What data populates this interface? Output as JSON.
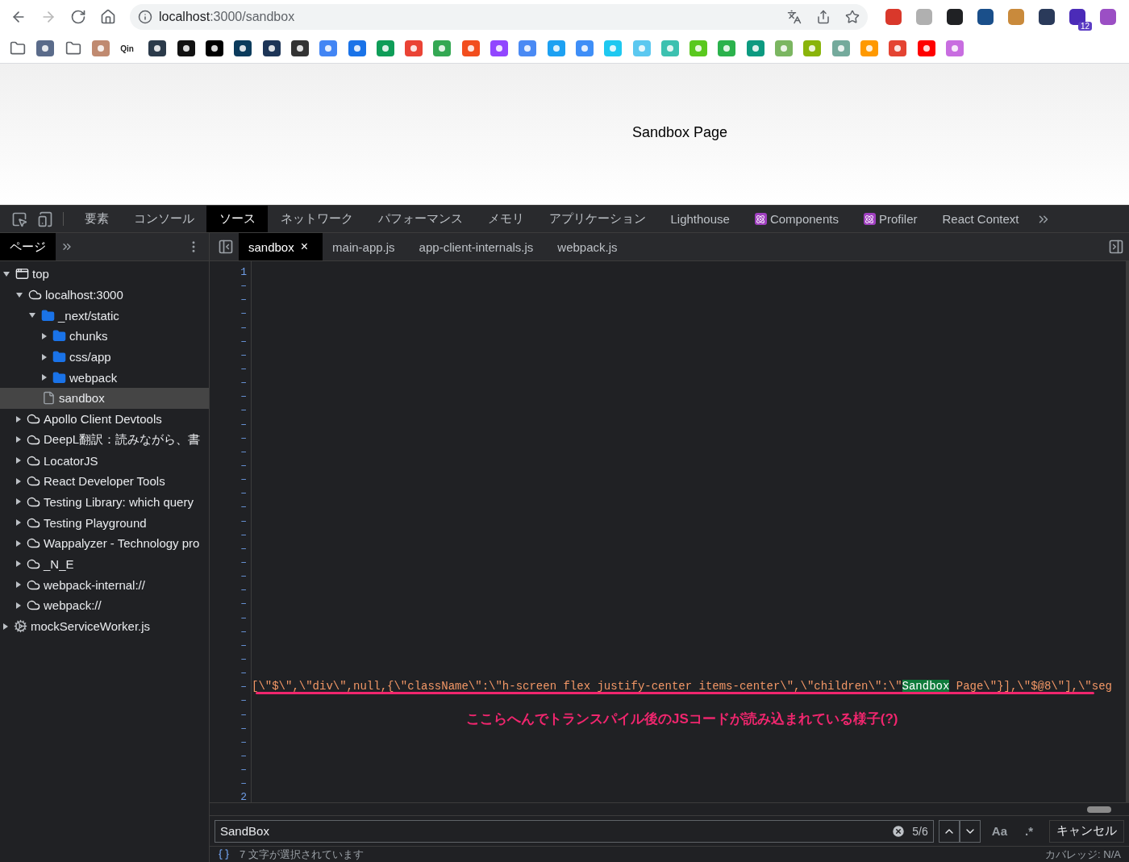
{
  "browser": {
    "nav": [
      {
        "kind": "back",
        "disabled": false
      },
      {
        "kind": "forward",
        "disabled": true
      },
      {
        "kind": "reload",
        "disabled": false
      },
      {
        "kind": "home",
        "disabled": false
      }
    ],
    "address": {
      "host": "localhost",
      "path": ":3000/sandbox"
    },
    "extensions": [
      {
        "color": "#d9382b"
      },
      {
        "color": "#b0b0b0"
      },
      {
        "color": "#202124"
      },
      {
        "color": "#1a4f8a"
      },
      {
        "color": "#c98a3c"
      },
      {
        "color": "#2a3a5a"
      },
      {
        "color": "#4b2bb8",
        "badge": "12"
      },
      {
        "color": "#9b4fc4"
      }
    ]
  },
  "bookmarks": [
    {
      "kind": "folder"
    },
    {
      "kind": "site",
      "color": "#5a6b8a"
    },
    {
      "kind": "folder"
    },
    {
      "kind": "site",
      "color": "#c08a70"
    },
    {
      "kind": "text",
      "label": "Qin"
    },
    {
      "kind": "site",
      "color": "#2b3a4a"
    },
    {
      "kind": "site",
      "color": "#111111"
    },
    {
      "kind": "site",
      "color": "#000000"
    },
    {
      "kind": "site",
      "color": "#0b3b5c"
    },
    {
      "kind": "site",
      "color": "#1d3557"
    },
    {
      "kind": "site",
      "color": "#333333"
    },
    {
      "kind": "site",
      "color": "#4285f4"
    },
    {
      "kind": "site",
      "color": "#1a73e8"
    },
    {
      "kind": "site",
      "color": "#0f9d58"
    },
    {
      "kind": "site",
      "color": "#ea4335"
    },
    {
      "kind": "site",
      "color": "#34a853"
    },
    {
      "kind": "site",
      "color": "#f24e1e"
    },
    {
      "kind": "site",
      "color": "#9146ff"
    },
    {
      "kind": "site",
      "color": "#4a8af4"
    },
    {
      "kind": "site",
      "color": "#1da1f2"
    },
    {
      "kind": "site",
      "color": "#3e8ef7"
    },
    {
      "kind": "site",
      "color": "#1ec8f0"
    },
    {
      "kind": "site",
      "color": "#5bc8f0"
    },
    {
      "kind": "site",
      "color": "#3cc1b0"
    },
    {
      "kind": "site",
      "color": "#5ac81e"
    },
    {
      "kind": "site",
      "color": "#2bb24c"
    },
    {
      "kind": "site",
      "color": "#0c9a80"
    },
    {
      "kind": "site",
      "color": "#7bb661"
    },
    {
      "kind": "site",
      "color": "#8ab40a"
    },
    {
      "kind": "site",
      "color": "#74aa9c"
    },
    {
      "kind": "site",
      "color": "#ff9900"
    },
    {
      "kind": "site",
      "color": "#e44332"
    },
    {
      "kind": "site",
      "color": "#ff0000"
    },
    {
      "kind": "site",
      "color": "#c86de0"
    }
  ],
  "page": {
    "heading": "Sandbox Page"
  },
  "devtools": {
    "tabs": [
      {
        "label": "要素",
        "kind": "plain",
        "selected": false
      },
      {
        "label": "コンソール",
        "kind": "plain",
        "selected": false
      },
      {
        "label": "ソース",
        "kind": "plain",
        "selected": true
      },
      {
        "label": "ネットワーク",
        "kind": "plain",
        "selected": false
      },
      {
        "label": "パフォーマンス",
        "kind": "plain",
        "selected": false
      },
      {
        "label": "メモリ",
        "kind": "plain",
        "selected": false
      },
      {
        "label": "アプリケーション",
        "kind": "plain",
        "selected": false
      },
      {
        "label": "Lighthouse",
        "kind": "plain",
        "selected": false
      },
      {
        "label": "Components",
        "kind": "react",
        "selected": false
      },
      {
        "label": "Profiler",
        "kind": "react",
        "selected": false
      },
      {
        "label": "React Context",
        "kind": "plain",
        "selected": false
      }
    ],
    "navigator_tab": {
      "label": "ページ",
      "selected": true
    },
    "tree": [
      {
        "label": "top",
        "kind": "frame",
        "expanded": true,
        "selected": false,
        "children": [
          {
            "label": "localhost:3000",
            "kind": "domain",
            "expanded": true,
            "selected": false,
            "children": [
              {
                "label": "_next/static",
                "kind": "folder",
                "expanded": true,
                "selected": false,
                "children": [
                  {
                    "label": "chunks",
                    "kind": "folder",
                    "expanded": false,
                    "selected": false
                  },
                  {
                    "label": "css/app",
                    "kind": "folder",
                    "expanded": false,
                    "selected": false
                  },
                  {
                    "label": "webpack",
                    "kind": "folder",
                    "expanded": false,
                    "selected": false
                  }
                ]
              },
              {
                "label": "sandbox",
                "kind": "file",
                "selected": true
              }
            ]
          },
          {
            "label": "Apollo Client Devtools",
            "kind": "domain",
            "expanded": false,
            "selected": false
          },
          {
            "label": "DeepL翻訳：読みながら、書",
            "kind": "domain",
            "expanded": false,
            "selected": false
          },
          {
            "label": "LocatorJS",
            "kind": "domain",
            "expanded": false,
            "selected": false
          },
          {
            "label": "React Developer Tools",
            "kind": "domain",
            "expanded": false,
            "selected": false
          },
          {
            "label": "Testing Library: which query",
            "kind": "domain",
            "expanded": false,
            "selected": false
          },
          {
            "label": "Testing Playground",
            "kind": "domain",
            "expanded": false,
            "selected": false
          },
          {
            "label": "Wappalyzer - Technology pro",
            "kind": "domain",
            "expanded": false,
            "selected": false
          },
          {
            "label": "_N_E",
            "kind": "domain",
            "expanded": false,
            "selected": false
          },
          {
            "label": "webpack-internal://",
            "kind": "domain",
            "expanded": false,
            "selected": false
          },
          {
            "label": "webpack://",
            "kind": "domain",
            "expanded": false,
            "selected": false
          }
        ]
      },
      {
        "label": "mockServiceWorker.js",
        "kind": "worker",
        "expanded": false,
        "selected": false
      }
    ],
    "editor_tabs": [
      {
        "label": "sandbox",
        "selected": true,
        "close": "×"
      },
      {
        "label": "main-app.js",
        "selected": false
      },
      {
        "label": "app-client-internals.js",
        "selected": false
      },
      {
        "label": "webpack.js",
        "selected": false
      }
    ],
    "lines": [
      {
        "number": "1"
      },
      {
        "number": "–"
      },
      {
        "number": "–"
      },
      {
        "number": "–"
      },
      {
        "number": "–"
      },
      {
        "number": "–"
      },
      {
        "number": "–"
      },
      {
        "number": "–"
      },
      {
        "number": "–"
      },
      {
        "number": "–"
      },
      {
        "number": "–"
      },
      {
        "number": "–"
      },
      {
        "number": "–"
      },
      {
        "number": "–"
      },
      {
        "number": "–"
      },
      {
        "number": "–"
      },
      {
        "number": "–"
      },
      {
        "number": "–"
      },
      {
        "number": "–"
      },
      {
        "number": "–"
      },
      {
        "number": "–"
      },
      {
        "number": "–"
      },
      {
        "number": "–"
      },
      {
        "number": "–"
      },
      {
        "number": "–"
      },
      {
        "number": "–"
      },
      {
        "number": "–"
      },
      {
        "number": "–"
      },
      {
        "number": "–"
      },
      {
        "number": "–"
      },
      {
        "number": "–",
        "code": {
          "before": "[\\\"$\\\",\\\"div\\\",null,{\\\"className\\\":\\\"h-screen flex justify-center items-center\\\",\\\"children\\\":\\\"",
          "match": "Sandbox",
          "after": " Page\\\"}],\\\"$@8\\\"],\\\"seg"
        }
      },
      {
        "number": "–"
      },
      {
        "number": "–"
      },
      {
        "number": "–"
      },
      {
        "number": "–"
      },
      {
        "number": "–"
      },
      {
        "number": "–"
      },
      {
        "number": "–"
      },
      {
        "number": "2"
      }
    ],
    "annotation": "ここらへんでトランスパイル後のJSコードが読み込まれている様子(?)",
    "search": {
      "value": "SandBox",
      "count": "5/6",
      "match_case": "Aa",
      "regex": ".*",
      "cancel": "キャンセル"
    },
    "status": {
      "selection": "7 文字が選択されています",
      "coverage": "カバレッジ: N/A"
    }
  }
}
